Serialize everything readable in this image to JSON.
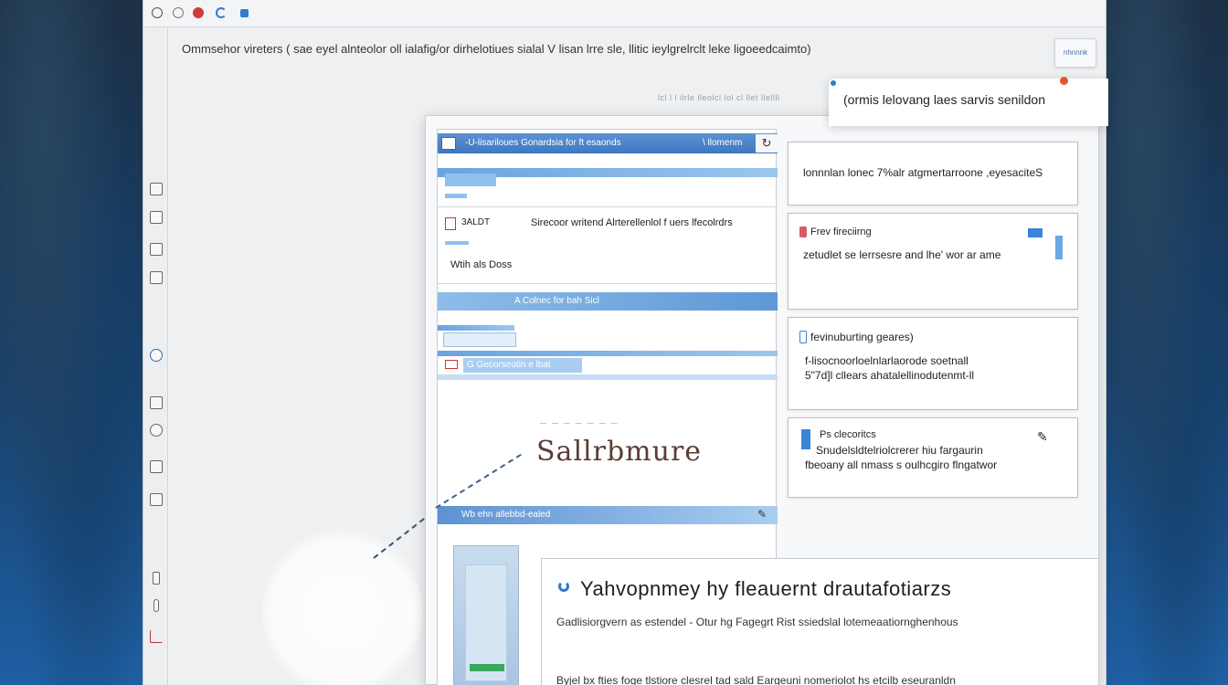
{
  "header": {
    "text": "Ommsehor vireters  ( sae  eyel  alnteolor oll ialafig/or  dirhelotiues sialal V  lisan lrre sle,  llitic ieylgrelrclt leke ligoeedcaimto)",
    "faint_line": "lcl l l ilrle  lleolcl lol cl llet llellll",
    "top_right_button": "nhnnnk"
  },
  "tooltip": {
    "text": "(ormis lelovang laes sarvis senildon"
  },
  "list": {
    "header_title": "-U-lisariloues Gonardsia for ft esaonds",
    "header_right": "\\ llomenm",
    "refresh_icon": "↻",
    "row_tag": "3ALDT",
    "row_text": "Sirecoor writend  Alrterellenlol  f uers  lfecolrdrs",
    "row_action": "Wtih als   Doss",
    "group1_header": "A Colnec for bah Sicl",
    "group2_header": "G Gecorseotin e lbat",
    "signature": "Sallrbmure",
    "signature_dash": "— — — — — — —",
    "bottom_strip": "Wb ehn allebbd-ealed"
  },
  "cards": [
    {
      "text": "lonnnlan lonec 7%alr atgmertarroone ,eyesaciteS"
    },
    {
      "title": "Frev fireciirng",
      "text": "zetudlet se lerrsesre and lhe' wor ar ame"
    },
    {
      "title": "fevinuburting geares)",
      "line1": "f-lisocnoorloelnlarlaorode soetnall",
      "line2": "5\"7d]l cllears ahatalellinodutenmt-ll"
    },
    {
      "title": "Ps clecoritcs",
      "line1": "Snudelsldtelriolcrerer hiu fargaurin",
      "line2": "fbeoany all nmass s oulhcgiro flngatwor"
    }
  ],
  "article": {
    "title": "Yahvopnmey  hy fleauernt  drautafotiarzs",
    "body1": "Gadlisiorgvern as estendel - Otur hg Fagegrt Rist ssiedslal lotemeaatiornghenhous",
    "body2": "Byjel bx fties  foge tlstiore clesrel tad sald Eargeuni  nomeriolot hs etcilb eseuranldn"
  },
  "colors": {
    "accent_blue": "#3f77c1",
    "accent_red": "#d23a3a",
    "desktop_bg": "#1a4f8a"
  }
}
